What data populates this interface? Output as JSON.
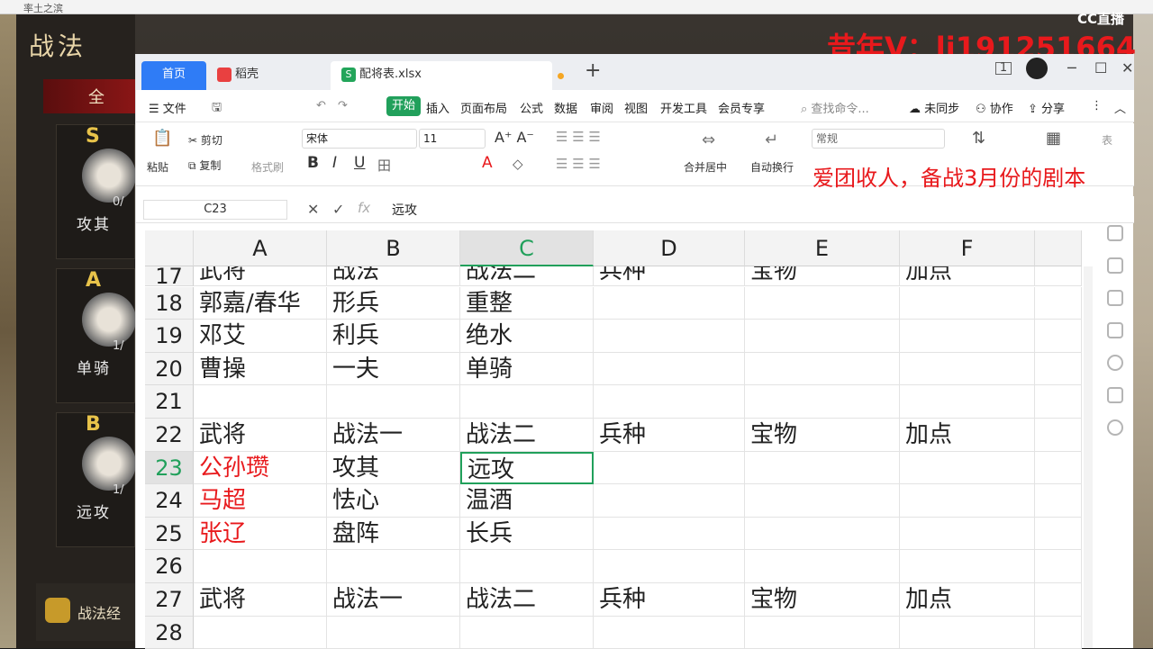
{
  "game": {
    "window_title": "率土之滨",
    "panel_title": "战法",
    "redbar_label": "全",
    "cards": [
      {
        "grade": "S",
        "count": "0/",
        "name": "攻其",
        "grade_color": "#e8c34a"
      },
      {
        "grade": "A",
        "count": "1/",
        "name": "单骑",
        "grade_color": "#e8c34a"
      },
      {
        "grade": "B",
        "count": "1/",
        "name": "远攻",
        "grade_color": "#e8c34a"
      }
    ],
    "bottom_label": "战法经"
  },
  "overlay": {
    "platform_logo": "CC直播",
    "contact": "昔年V：li191251664",
    "note": "爱团收人，备战3月份的剧本"
  },
  "tabs": {
    "home": "首页",
    "daoke": "稻壳",
    "file": "配将表.xlsx",
    "new_tab": "+"
  },
  "menu": {
    "file": "文件",
    "items": [
      "开始",
      "插入",
      "页面布局",
      "公式",
      "数据",
      "审阅",
      "视图",
      "开发工具",
      "会员专享"
    ],
    "search": "查找命令...",
    "sync": "未同步",
    "collab": "协作",
    "share": "分享"
  },
  "ribbon": {
    "paste": "粘贴",
    "cut": "剪切",
    "copy": "复制",
    "format_painter": "格式刷",
    "font_name": "宋体",
    "font_size": "11",
    "merge_center": "合并居中",
    "wrap": "自动换行",
    "number_format": "常规",
    "type_convert": "类型转换",
    "cond_format": "条件格式",
    "table_style": "表"
  },
  "formula_bar": {
    "cell_ref": "C23",
    "value": "远攻"
  },
  "sheet": {
    "columns": [
      "A",
      "B",
      "C",
      "D",
      "E",
      "F"
    ],
    "active_column": "C",
    "active_row": "23",
    "rows": [
      {
        "num": "17",
        "cells": [
          "武将",
          "战法",
          "战法二",
          "兵种",
          "宝物",
          "加点"
        ],
        "red": false
      },
      {
        "num": "18",
        "cells": [
          "郭嘉/春华",
          "形兵",
          "重整",
          "",
          "",
          ""
        ],
        "red": false
      },
      {
        "num": "19",
        "cells": [
          "邓艾",
          "利兵",
          "绝水",
          "",
          "",
          ""
        ],
        "red": false
      },
      {
        "num": "20",
        "cells": [
          "曹操",
          "一夫",
          "单骑",
          "",
          "",
          ""
        ],
        "red": false
      },
      {
        "num": "21",
        "cells": [
          "",
          "",
          "",
          "",
          "",
          ""
        ],
        "red": false
      },
      {
        "num": "22",
        "cells": [
          "武将",
          "战法一",
          "战法二",
          "兵种",
          "宝物",
          "加点"
        ],
        "red": false
      },
      {
        "num": "23",
        "cells": [
          "公孙瓒",
          "攻其",
          "远攻",
          "",
          "",
          ""
        ],
        "red": true
      },
      {
        "num": "24",
        "cells": [
          "马超",
          "怯心",
          "温酒",
          "",
          "",
          ""
        ],
        "red": true
      },
      {
        "num": "25",
        "cells": [
          "张辽",
          "盘阵",
          "长兵",
          "",
          "",
          ""
        ],
        "red": true
      },
      {
        "num": "26",
        "cells": [
          "",
          "",
          "",
          "",
          "",
          ""
        ],
        "red": false
      },
      {
        "num": "27",
        "cells": [
          "武将",
          "战法一",
          "战法二",
          "兵种",
          "宝物",
          "加点"
        ],
        "red": false
      },
      {
        "num": "28",
        "cells": [
          "",
          "",
          "",
          "",
          "",
          ""
        ],
        "red": false
      }
    ]
  }
}
